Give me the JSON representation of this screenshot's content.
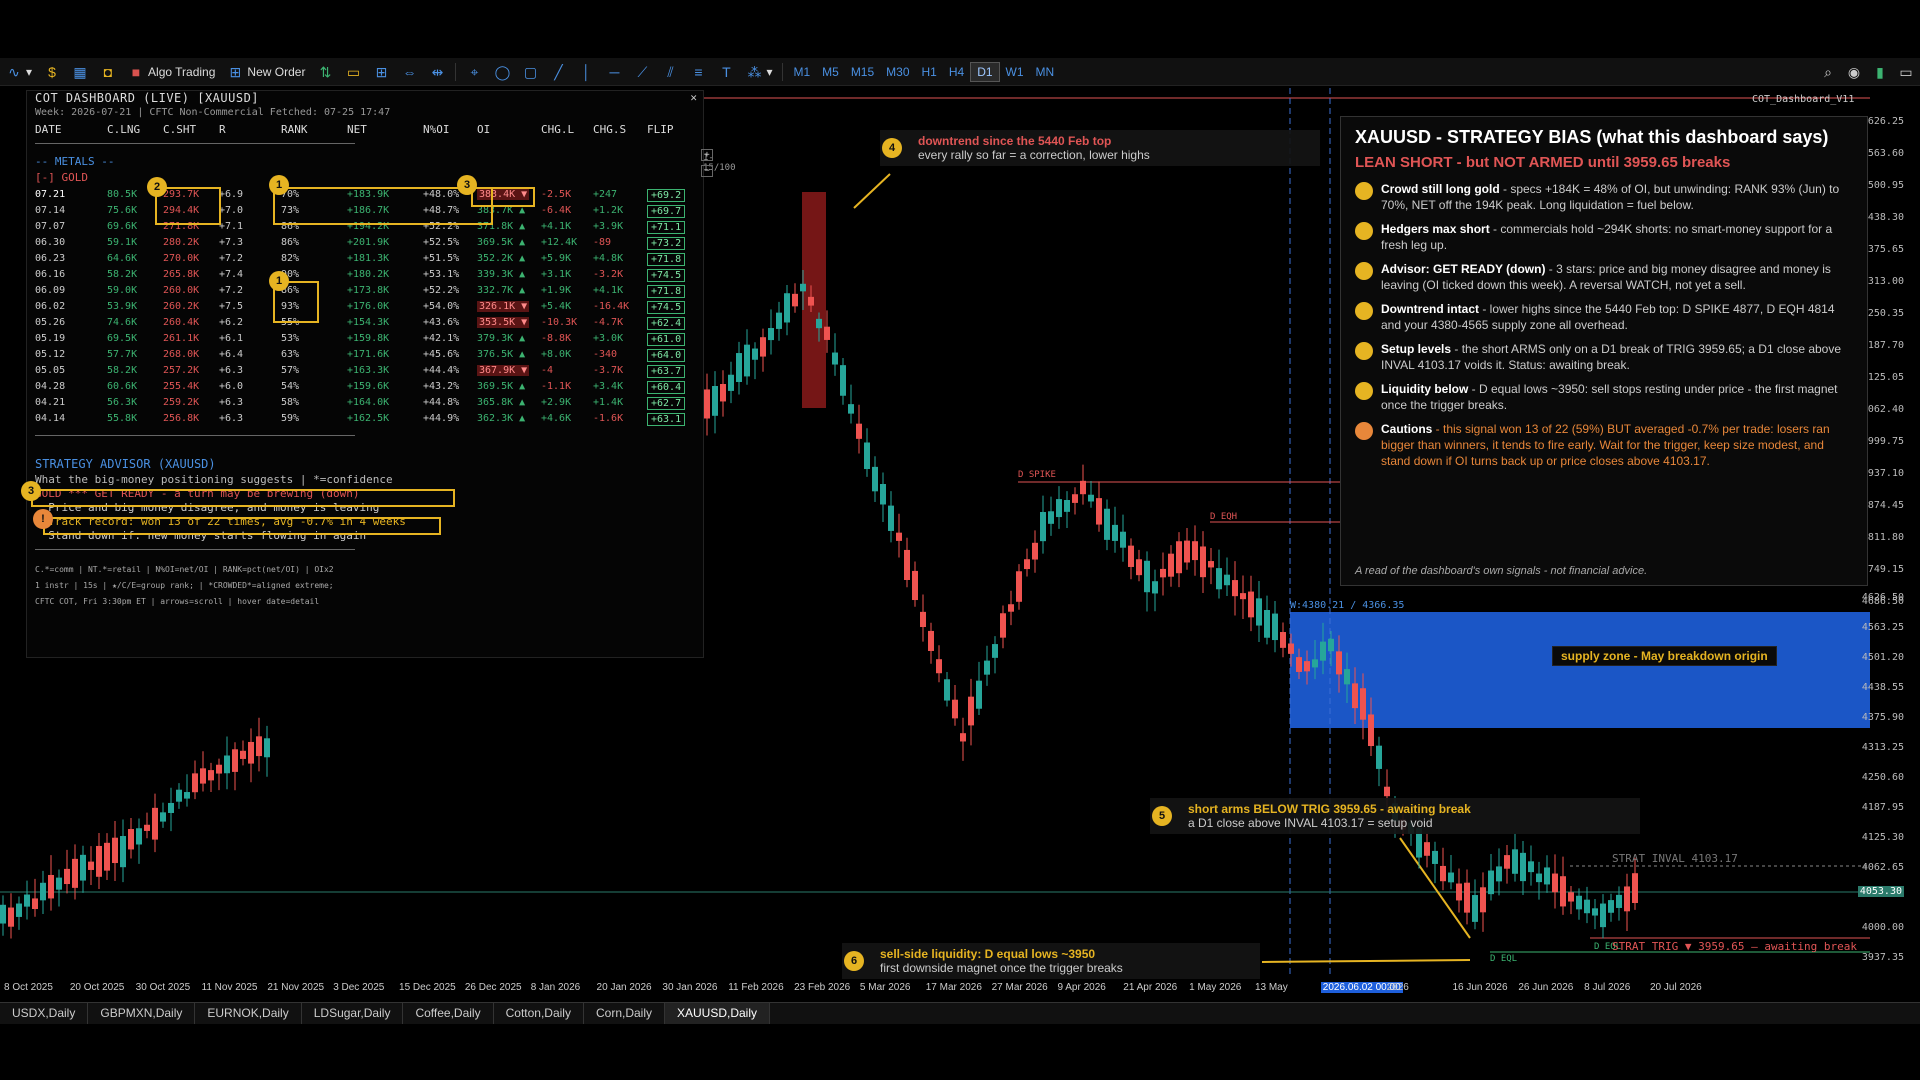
{
  "toolbar": {
    "algo_trading": "Algo Trading",
    "new_order": "New Order",
    "timeframes": [
      "M1",
      "M5",
      "M15",
      "M30",
      "H1",
      "H4",
      "D1",
      "W1",
      "MN"
    ],
    "active_tf": "D1"
  },
  "cot": {
    "title": "COT DASHBOARD  (LIVE)  [XAUUSD]",
    "subtitle": "Week: 2026-07-21 | CFTC Non-Commercial            Fetched: 07-25 17:47",
    "columns": [
      "DATE",
      "C.LNG",
      "C.SHT",
      "R",
      "RANK",
      "NET",
      "N%OI",
      "OI",
      "CHG.L",
      "CHG.S",
      "FLIP"
    ],
    "section_metals": "-- METALS --",
    "group": "[-] GOLD",
    "rows": [
      [
        "07.21",
        "80.5K",
        "293.7K",
        "+6.9",
        "70%",
        "+183.9K",
        "+48.0%",
        "383.4K ▼",
        "-2.5K",
        "+247",
        "+69.2"
      ],
      [
        "07.14",
        "75.6K",
        "294.4K",
        "+7.0",
        "73%",
        "+186.7K",
        "+48.7%",
        "383.7K ▲",
        "-6.4K",
        "+1.2K",
        "+69.7"
      ],
      [
        "07.07",
        "69.6K",
        "271.8K",
        "+7.1",
        "86%",
        "+194.2K",
        "+52.2%",
        "371.8K ▲",
        "+4.1K",
        "+3.9K",
        "+71.1"
      ],
      [
        "06.30",
        "59.1K",
        "280.2K",
        "+7.3",
        "86%",
        "+201.9K",
        "+52.5%",
        "369.5K ▲",
        "+12.4K",
        "-89",
        "+73.2"
      ],
      [
        "06.23",
        "64.6K",
        "270.0K",
        "+7.2",
        "82%",
        "+181.3K",
        "+51.5%",
        "352.2K ▲",
        "+5.9K",
        "+4.8K",
        "+71.8"
      ],
      [
        "06.16",
        "58.2K",
        "265.8K",
        "+7.4",
        "90%",
        "+180.2K",
        "+53.1%",
        "339.3K ▲",
        "+3.1K",
        "-3.2K",
        "+74.5"
      ],
      [
        "06.09",
        "59.0K",
        "260.0K",
        "+7.2",
        "86%",
        "+173.8K",
        "+52.2%",
        "332.7K ▲",
        "+1.9K",
        "+4.1K",
        "+71.8"
      ],
      [
        "06.02",
        "53.9K",
        "260.2K",
        "+7.5",
        "93%",
        "+176.0K",
        "+54.0%",
        "326.1K ▼",
        "+5.4K",
        "-16.4K",
        "+74.5"
      ],
      [
        "05.26",
        "74.6K",
        "260.4K",
        "+6.2",
        "55%",
        "+154.3K",
        "+43.6%",
        "353.5K ▼",
        "-10.3K",
        "-4.7K",
        "+62.4"
      ],
      [
        "05.19",
        "69.5K",
        "261.1K",
        "+6.1",
        "53%",
        "+159.8K",
        "+42.1%",
        "379.3K ▲",
        "-8.8K",
        "+3.0K",
        "+61.0"
      ],
      [
        "05.12",
        "57.7K",
        "268.0K",
        "+6.4",
        "63%",
        "+171.6K",
        "+45.6%",
        "376.5K ▲",
        "+8.0K",
        "-340",
        "+64.0"
      ],
      [
        "05.05",
        "58.2K",
        "257.2K",
        "+6.3",
        "57%",
        "+163.3K",
        "+44.4%",
        "367.9K ▼",
        "-4",
        "-3.7K",
        "+63.7"
      ],
      [
        "04.28",
        "60.6K",
        "255.4K",
        "+6.0",
        "54%",
        "+159.6K",
        "+43.2%",
        "369.5K ▲",
        "-1.1K",
        "+3.4K",
        "+60.4"
      ],
      [
        "04.21",
        "56.3K",
        "259.2K",
        "+6.3",
        "58%",
        "+164.0K",
        "+44.8%",
        "365.8K ▲",
        "+2.9K",
        "+1.4K",
        "+62.7"
      ],
      [
        "04.14",
        "55.8K",
        "256.8K",
        "+6.3",
        "59%",
        "+162.5K",
        "+44.9%",
        "362.3K ▲",
        "+4.6K",
        "-1.6K",
        "+63.1"
      ]
    ],
    "advisor_title": "STRATEGY ADVISOR  (XAUUSD)",
    "advisor_sub": "What the big-money positioning suggests | *=confidence",
    "advisor_line1": "GOLD  ***  GET READY - a turn may be brewing (down)",
    "advisor_line2": "  Price and big money disagree, and money is leaving",
    "advisor_line3": "  Track record: won 13 of 22 times, avg -0.7% in 4 weeks",
    "advisor_line4": "  Stand down if: new money starts flowing in again",
    "legend1": "C.*=comm | NT.*=retail | N%OI=net/OI | RANK=pct(net/OI) | OIx2",
    "legend2": "1 instr | 15s | ★/C/E=group rank; | *CROWDED*=aligned extreme;",
    "legend3": "CFTC COT, Fri 3:30pm ET | arrows=scroll | hover date=detail",
    "scroll_info": "1-15/100"
  },
  "bias": {
    "title": "XAUUSD - STRATEGY BIAS (what this dashboard says)",
    "lean": "LEAN SHORT - but NOT ARMED until 3959.65 breaks",
    "items": [
      {
        "head": "Crowd still long gold",
        "body": " - specs +184K = 48% of OI, but unwinding: RANK 93% (Jun) to 70%, NET off the 194K peak. Long liquidation = fuel below."
      },
      {
        "head": "Hedgers max short",
        "body": " - commercials hold ~294K shorts: no smart-money support for a fresh leg up."
      },
      {
        "head": "Advisor: GET READY (down)",
        "body": " - 3 stars: price and big money disagree and money is leaving (OI ticked down this week). A reversal WATCH, not yet a sell."
      },
      {
        "head": "Downtrend intact",
        "body": " - lower highs since the 5440 Feb top: D SPIKE 4877, D EQH 4814 and your 4380-4565 supply zone all overhead."
      },
      {
        "head": "Setup levels",
        "body": " - the short ARMS only on a D1 break of TRIG 3959.65; a D1 close above INVAL 4103.17 voids it. Status: awaiting break."
      },
      {
        "head": "Liquidity below",
        "body": " - D equal lows ~3950: sell stops resting under price - the first magnet once the trigger breaks."
      }
    ],
    "caution_head": "Cautions",
    "caution_body": " - this signal won 13 of 22 (59%) BUT averaged -0.7% per trade: losers ran bigger than winners, it tends to fire early. Wait for the trigger, keep size modest, and stand down if OI turns back up or price closes above 4103.17.",
    "footer": "A read of the dashboard's own signals - not financial advice."
  },
  "notes": {
    "n4_title": "downtrend since the 5440 Feb top",
    "n4_sub": "every rally so far = a correction, lower highs",
    "n5_title": "short arms BELOW TRIG 3959.65 - awaiting break",
    "n5_sub": "a D1 close above INVAL 4103.17 = setup void",
    "n6_title": "sell-side liquidity: D equal lows ~3950",
    "n6_sub": "first downside magnet once the trigger breaks",
    "supply": "supply zone - May breakdown origin",
    "d_spike": "D SPIKE",
    "d_eqh": "D EQH",
    "d_eql": "D EQL",
    "strat_inval": "STRAT INVAL 4103.17",
    "strat_trig": "STRAT TRIG ▼ 3959.65 — awaiting break",
    "zone_label": "W:4380.21 / 4366.35",
    "indicator_label": "COT_Dashboard_V11"
  },
  "price_axis": [
    "4626.50",
    "4563.25",
    "4501.20",
    "4438.55",
    "4375.90",
    "4313.25",
    "4250.60",
    "4187.95",
    "4125.30",
    "4062.65",
    "4053.30",
    "4000.00",
    "3937.35"
  ],
  "price_axis_top": [
    "5626.25",
    "5563.60",
    "5500.95",
    "5438.30",
    "5375.65",
    "5313.00",
    "5250.35",
    "5187.70",
    "5125.05",
    "5062.40",
    "4999.75",
    "4937.10",
    "4874.45",
    "4811.80",
    "4749.15",
    "4686.50"
  ],
  "dates": [
    "8 Oct 2025",
    "20 Oct 2025",
    "30 Oct 2025",
    "11 Nov 2025",
    "21 Nov 2025",
    "3 Dec 2025",
    "15 Dec 2025",
    "26 Dec 2025",
    "8 Jan 2026",
    "20 Jan 2026",
    "30 Jan 2026",
    "11 Feb 2026",
    "23 Feb 2026",
    "5 Mar 2026",
    "17 Mar 2026",
    "27 Mar 2026",
    "9 Apr 2026",
    "21 Apr 2026",
    "1 May 2026",
    "13 May",
    "2026.06.02 00:00",
    "2026",
    "16 Jun 2026",
    "26 Jun 2026",
    "8 Jul 2026",
    "20 Jul 2026"
  ],
  "tabs": [
    "USDX,Daily",
    "GBPMXN,Daily",
    "EURNOK,Daily",
    "LDSugar,Daily",
    "Coffee,Daily",
    "Cotton,Daily",
    "Corn,Daily",
    "XAUUSD,Daily"
  ],
  "active_tab": "XAUUSD,Daily",
  "colors": {
    "bull": "#26a69a",
    "bear": "#ef5350",
    "accent": "#e6b422",
    "zone": "#1e5fdc"
  }
}
